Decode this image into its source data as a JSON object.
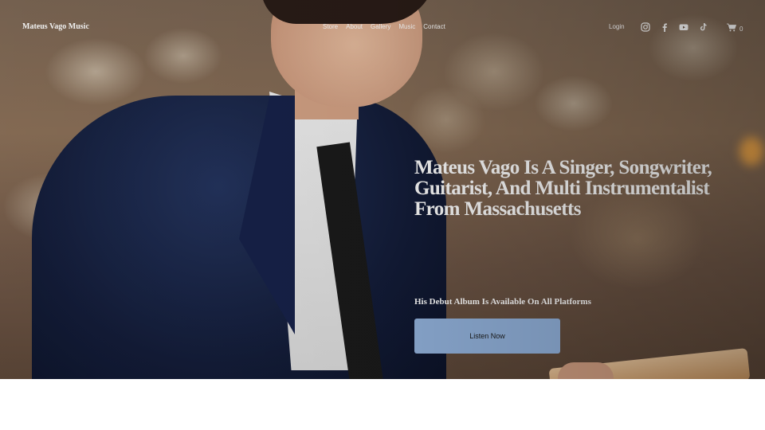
{
  "header": {
    "site_title": "Mateus Vago Music",
    "nav": [
      "Store",
      "About",
      "Gallery",
      "Music",
      "Contact"
    ],
    "login_label": "Login",
    "social_icons": [
      "instagram-icon",
      "facebook-icon",
      "youtube-icon",
      "tiktok-icon"
    ],
    "cart_count": "0"
  },
  "hero": {
    "headline": "Mateus Vago Is A Singer, Songwriter, Guitarist, And Multi Instrumentalist From Massachusetts",
    "subline": "His Debut Album Is Available On All Platforms",
    "cta_label": "Listen Now",
    "cta_color": "#93b3dd"
  }
}
